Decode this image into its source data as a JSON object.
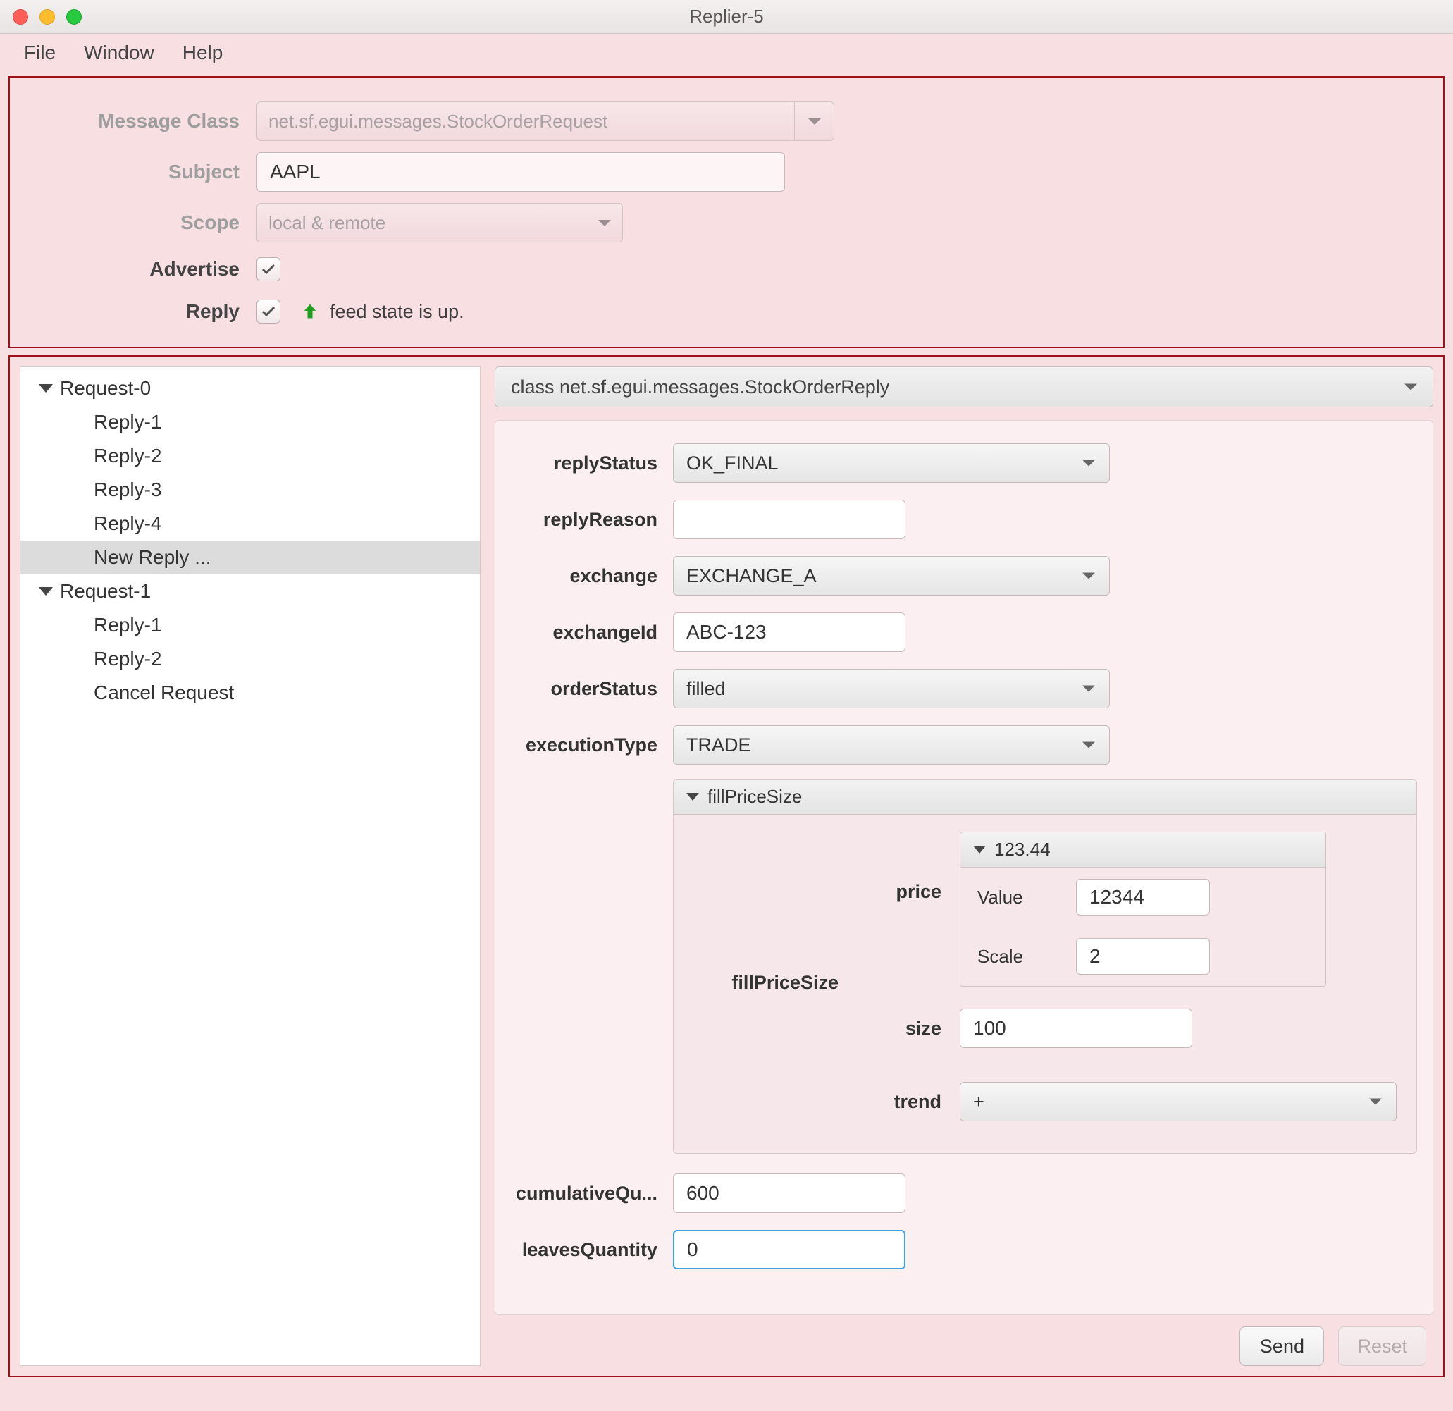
{
  "app_title": "Replier-5",
  "menubar": {
    "file": "File",
    "window": "Window",
    "help": "Help"
  },
  "top": {
    "labels": {
      "messageClass": "Message Class",
      "subject": "Subject",
      "scope": "Scope",
      "advertise": "Advertise",
      "reply": "Reply"
    },
    "messageClass": "net.sf.egui.messages.StockOrderRequest",
    "subject": "AAPL",
    "scope": "local & remote",
    "advertise": true,
    "reply": true,
    "feedStatus": "feed state is up."
  },
  "tree": {
    "items": [
      {
        "type": "node",
        "label": "Request-0"
      },
      {
        "type": "leaf",
        "label": "Reply-1"
      },
      {
        "type": "leaf",
        "label": "Reply-2"
      },
      {
        "type": "leaf",
        "label": "Reply-3"
      },
      {
        "type": "leaf",
        "label": "Reply-4"
      },
      {
        "type": "leaf",
        "label": "New Reply ...",
        "selected": true
      },
      {
        "type": "node",
        "label": "Request-1"
      },
      {
        "type": "leaf",
        "label": "Reply-1"
      },
      {
        "type": "leaf",
        "label": "Reply-2"
      },
      {
        "type": "leaf",
        "label": "Cancel Request"
      }
    ]
  },
  "content": {
    "classSelector": "class net.sf.egui.messages.StockOrderReply",
    "labels": {
      "replyStatus": "replyStatus",
      "replyReason": "replyReason",
      "exchange": "exchange",
      "exchangeId": "exchangeId",
      "orderStatus": "orderStatus",
      "executionType": "executionType",
      "fillPriceSizeGroup": "fillPriceSize",
      "fillPriceSize": "fillPriceSize",
      "price": "price",
      "size": "size",
      "trend": "trend",
      "priceHeader": "123.44",
      "value": "Value",
      "scale": "Scale",
      "cumulativeQuantity": "cumulativeQu...",
      "leavesQuantity": "leavesQuantity"
    },
    "replyStatus": "OK_FINAL",
    "replyReason": "",
    "exchange": "EXCHANGE_A",
    "exchangeId": "ABC-123",
    "orderStatus": "filled",
    "executionType": "TRADE",
    "price": {
      "value": "12344",
      "scale": "2"
    },
    "size": "100",
    "trend": "+",
    "cumulativeQuantity": "600",
    "leavesQuantity": "0"
  },
  "footer": {
    "send": "Send",
    "reset": "Reset"
  }
}
